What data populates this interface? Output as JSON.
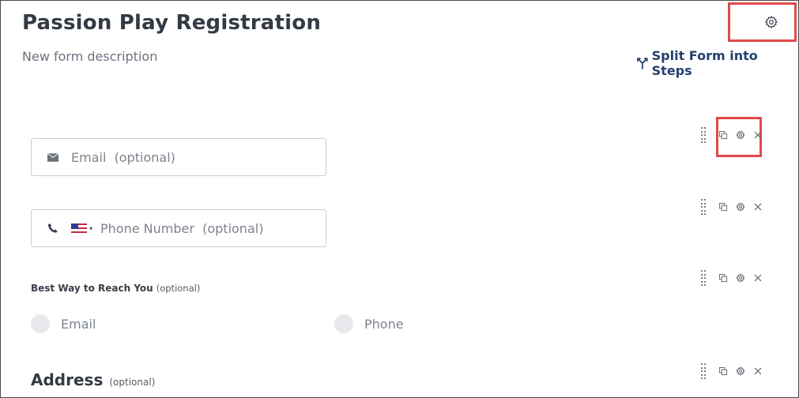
{
  "form": {
    "title": "Passion Play Registration",
    "description": "New form description",
    "split_link": "Split Form into Steps"
  },
  "fields": {
    "email": {
      "placeholder": "Email",
      "optional": "(optional)"
    },
    "phone": {
      "placeholder": "Phone Number",
      "optional": "(optional)",
      "country_flag": "US"
    },
    "reach": {
      "label": "Best Way to Reach You",
      "optional": "(optional)",
      "options": [
        "Email",
        "Phone"
      ]
    },
    "address": {
      "label": "Address",
      "optional": "(optional)"
    }
  },
  "row_actions": [
    "drag-handle-icon",
    "copy-icon",
    "gear-icon",
    "close-icon"
  ],
  "colors": {
    "highlight": "#e14a4a",
    "link": "#24406e",
    "title": "#333a44",
    "placeholder": "#7d838c",
    "radio_fill": "#e8e9ec"
  }
}
